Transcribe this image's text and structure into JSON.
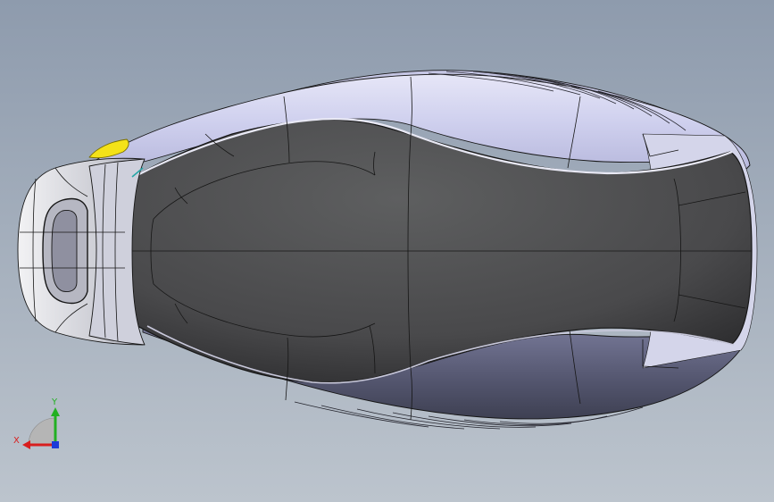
{
  "viewport": {
    "background_top": "#8f9cad",
    "background_bottom": "#b9c2cc"
  },
  "model": {
    "upper_body_color": "#d8d9ef",
    "lower_body_color": "#5c5f7a",
    "top_cover_color": "#5a5b5d",
    "key_ring_color": "#d7d8de",
    "led_color": "#f2e21c",
    "edge_color": "#1a1a1a"
  },
  "triad": {
    "x_label": "X",
    "y_label": "Y",
    "x_color": "#d81e1e",
    "y_color": "#22b022",
    "z_color": "#1e3cd8"
  }
}
